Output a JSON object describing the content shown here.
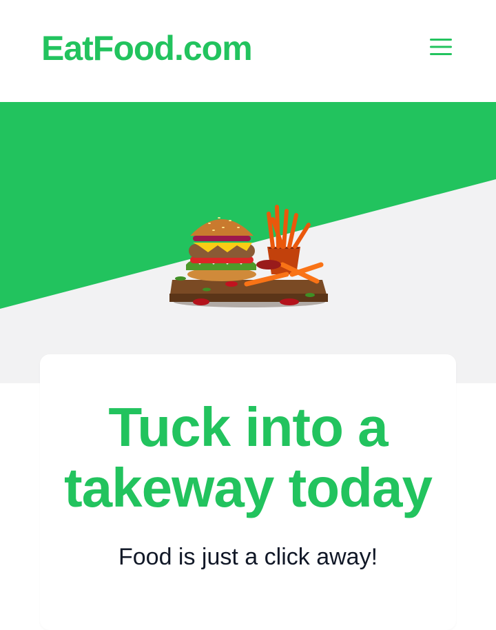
{
  "header": {
    "logo_text": "EatFood.com",
    "menu_icon": "hamburger-menu-icon"
  },
  "hero": {
    "image_subject": "burger-and-fries-icon"
  },
  "card": {
    "headline": "Tuck into a takeway today",
    "subheadline": "Food is just a click away!"
  },
  "colors": {
    "brand_green": "#22c35e",
    "hero_light": "#f2f2f3",
    "text_dark": "#111827"
  }
}
